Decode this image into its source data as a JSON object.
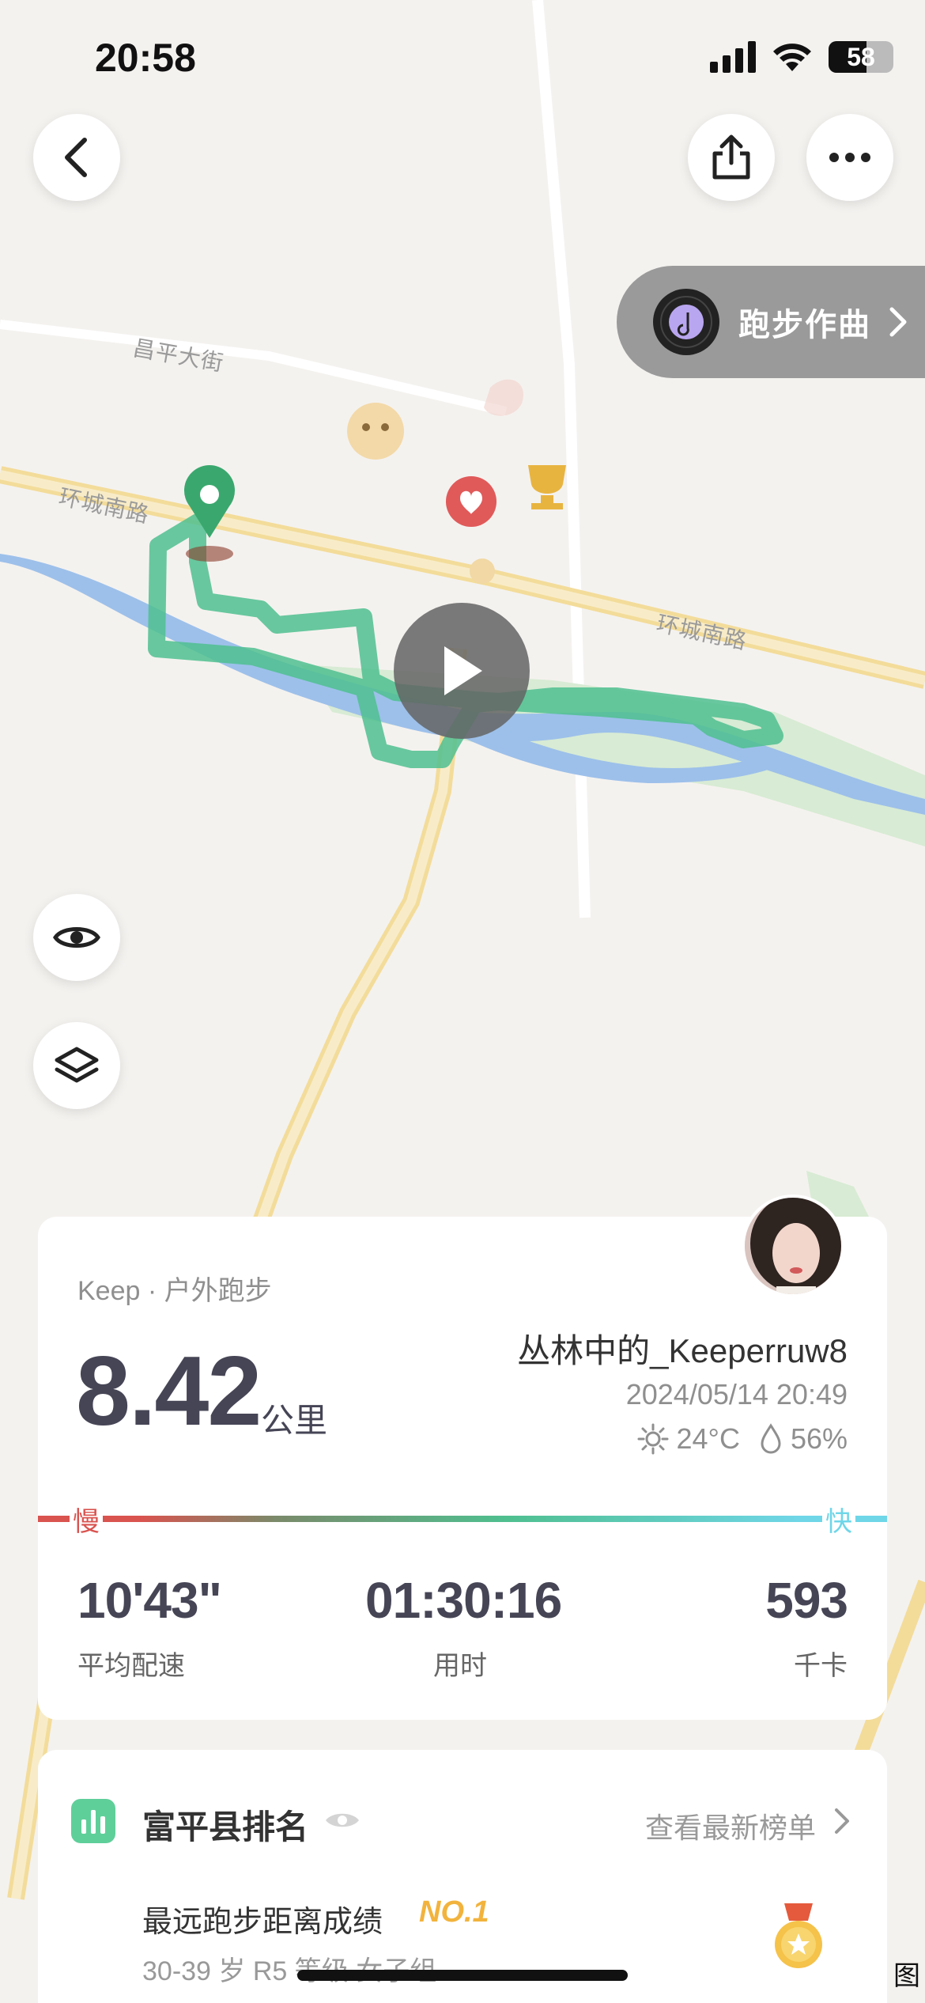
{
  "status_bar": {
    "time": "20:58",
    "battery": "58"
  },
  "map": {
    "labels": {
      "street_1": "昌平大街",
      "road_1": "环城南路",
      "road_2": "环城南路"
    }
  },
  "top_actions": {
    "back_icon": "chevron-left-icon",
    "share_icon": "share-icon",
    "more_icon": "more-dots-icon"
  },
  "compose": {
    "label": "跑步作曲"
  },
  "side_actions": {
    "eye_icon": "eye-icon",
    "layers_icon": "layers-icon"
  },
  "stats_card": {
    "source": "Keep · 户外跑步",
    "distance": "8.42",
    "distance_unit": "公里",
    "user_name": "丛林中的_Keeperruw8",
    "datetime": "2024/05/14 20:49",
    "temperature": "24°C",
    "humidity": "56%",
    "pace_slow_label": "慢",
    "pace_fast_label": "快",
    "avg_pace": "10'43\"",
    "avg_pace_label": "平均配速",
    "duration": "01:30:16",
    "duration_label": "用时",
    "calories": "593",
    "calories_label": "千卡"
  },
  "ranking": {
    "title": "富平县排名",
    "link": "查看最新榜单",
    "item_label": "最远跑步距离成绩",
    "item_rank": "NO.1",
    "item_sub": "30-39 岁 R5 等级 女子组"
  },
  "corner_glyph": "图",
  "colors": {
    "route_green": "#4fbf8f",
    "river_blue": "#9dc0ea",
    "road_yellow": "#f3dc9a",
    "accent_red": "#d9534f",
    "accent_cyan": "#6fd6e8",
    "rank_gold": "#f2b33d"
  }
}
